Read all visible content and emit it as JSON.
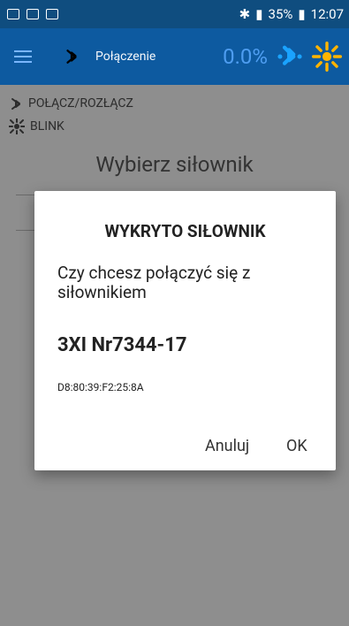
{
  "status_bar": {
    "battery": "35%",
    "time": "12:07"
  },
  "app_bar": {
    "title": "Połączenie",
    "progress": "0.0%"
  },
  "menu_rows": [
    {
      "label": "POŁĄCZ/ROZŁĄCZ",
      "icon": "bluetooth-icon"
    },
    {
      "label": "BLINK",
      "icon": "blink-icon"
    }
  ],
  "section_title": "Wybierz siłownik",
  "dialog": {
    "title": "WYKRYTO SIŁOWNIK",
    "message": "Czy chcesz połączyć się z siłownikiem",
    "device_name": "3XI Nr7344-17",
    "mac": "D8:80:39:F2:25:8A",
    "cancel_label": "Anuluj",
    "ok_label": "OK"
  },
  "colors": {
    "app_bar": "#0d5aa0",
    "status_bar": "#0f4d7f",
    "overlay": "#8e8e8e"
  }
}
